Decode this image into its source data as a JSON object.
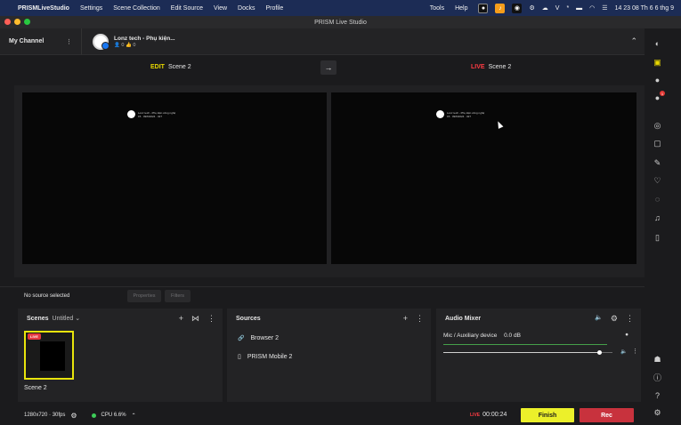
{
  "menubar": {
    "apple": "",
    "app_name": "PRISMLiveStudio",
    "items": [
      "Settings",
      "Scene Collection",
      "Edit Source",
      "View",
      "Docks",
      "Profile"
    ],
    "right_items": [
      "Tools",
      "Help"
    ],
    "clock": "14 23 08 Th 6 6 thg 9",
    "tray_v": "V",
    "tray_bt": "*"
  },
  "window": {
    "title": "PRISM Live Studio"
  },
  "channel": {
    "title": "My Channel",
    "account_name": "Lonz tech - Phụ kiện...",
    "account_stats": "👤 0  👍 0"
  },
  "modes": {
    "edit_tag": "EDIT",
    "edit_scene": "Scene 2",
    "live_tag": "LIVE",
    "live_scene": "Scene 2",
    "swap_icon": "→"
  },
  "overlay": {
    "line1": "Lonz tech - Phụ kiện công nghệ",
    "line2": "15 · 09/6/2024 · 327"
  },
  "source_bar": {
    "no_selection": "No source selected",
    "properties": "Properties",
    "filters": "Filters"
  },
  "scenes": {
    "title": "Scenes",
    "collection": "Untitled ⌄",
    "add_icon": "+",
    "transition_icon": "⋈",
    "more_icon": "⋮",
    "live_tag": "LIVE",
    "scene_name": "Scene 2"
  },
  "sources": {
    "title": "Sources",
    "add_icon": "+",
    "more_icon": "⋮",
    "items": [
      {
        "icon": "🔗",
        "label": "Browser 2"
      },
      {
        "icon": "▯",
        "label": "PRISM Mobile 2"
      }
    ]
  },
  "mixer": {
    "title": "Audio Mixer",
    "speaker_icon": "🔈",
    "gear_icon": "⚙",
    "more_icon": "⋮",
    "track_name": "Mic / Auxiliary device",
    "track_level": "0.0 dB",
    "track_dot": "●",
    "track_speaker": "🔈",
    "track_more": "⋮",
    "level": 0.92
  },
  "status": {
    "resolution": "1280x720 · 30fps",
    "gear_icon": "⚙",
    "cpu": "CPU 6.6%",
    "cpu_chevron": "⌃",
    "live_tag": "LIVE",
    "live_time": "00:00:24",
    "finish_label": "Finish",
    "rec_label": "Rec"
  },
  "sidebar": {
    "notification_count": "1"
  },
  "colors": {
    "edit_accent": "#e8d800",
    "live_accent": "#ff3b43",
    "finish_bg": "#ecf02a",
    "rec_bg": "#c8323d",
    "cpu_ok": "#3dcd58"
  }
}
